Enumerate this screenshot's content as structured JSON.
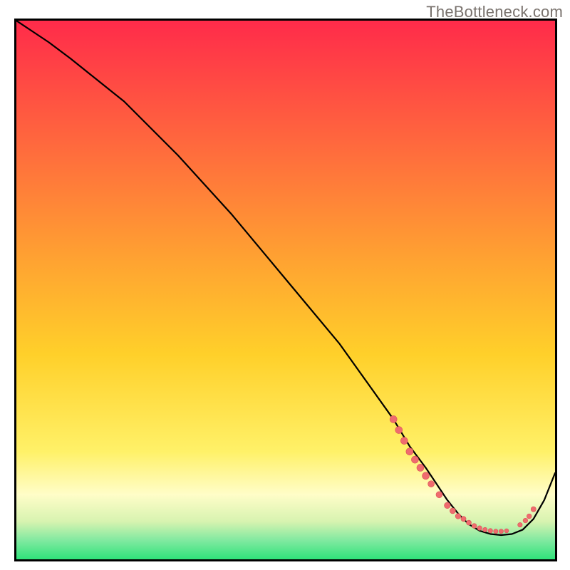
{
  "attribution": "TheBottleneck.com",
  "colors": {
    "top": "#ff2b4a",
    "mid": "#ffd02a",
    "pale": "#fffdc8",
    "green": "#2fe37a",
    "curve": "#000000",
    "dot_fill": "#ef6b6e",
    "dot_stroke": "#da5457"
  },
  "chart_data": {
    "type": "line",
    "title": "",
    "xlabel": "",
    "ylabel": "",
    "xlim": [
      0,
      100
    ],
    "ylim": [
      0,
      100
    ],
    "x": [
      0,
      3,
      6,
      10,
      15,
      20,
      30,
      40,
      50,
      60,
      65,
      70,
      73,
      76,
      78,
      80,
      82,
      84,
      86,
      88,
      90,
      92,
      94,
      96,
      98,
      100
    ],
    "values": [
      100,
      98,
      96,
      93,
      89,
      85,
      75,
      64,
      52,
      40,
      33,
      26,
      21,
      17,
      14,
      11,
      8.5,
      6.5,
      5.3,
      4.7,
      4.5,
      4.7,
      5.5,
      7.5,
      11,
      16
    ],
    "gradient_stops": [
      {
        "offset": 0,
        "color": "#ff2b4a"
      },
      {
        "offset": 0.45,
        "color": "#ffa431"
      },
      {
        "offset": 0.62,
        "color": "#ffd02a"
      },
      {
        "offset": 0.8,
        "color": "#fff168"
      },
      {
        "offset": 0.88,
        "color": "#fffdc8"
      },
      {
        "offset": 0.93,
        "color": "#d7f3b0"
      },
      {
        "offset": 0.965,
        "color": "#80e9a0"
      },
      {
        "offset": 1.0,
        "color": "#2fe37a"
      }
    ],
    "dots": [
      {
        "x": 70.0,
        "y": 26.0,
        "r": 5
      },
      {
        "x": 71.0,
        "y": 24.0,
        "r": 5
      },
      {
        "x": 72.0,
        "y": 22.0,
        "r": 5
      },
      {
        "x": 73.0,
        "y": 20.0,
        "r": 5
      },
      {
        "x": 74.0,
        "y": 18.5,
        "r": 5
      },
      {
        "x": 75.0,
        "y": 17.0,
        "r": 5
      },
      {
        "x": 76.0,
        "y": 15.5,
        "r": 5
      },
      {
        "x": 77.0,
        "y": 14.0,
        "r": 4.5
      },
      {
        "x": 78.5,
        "y": 12.0,
        "r": 4.5
      },
      {
        "x": 80.0,
        "y": 10.0,
        "r": 4.3
      },
      {
        "x": 81.0,
        "y": 9.0,
        "r": 4.0
      },
      {
        "x": 82.0,
        "y": 8.0,
        "r": 3.8
      },
      {
        "x": 83.0,
        "y": 7.5,
        "r": 3.6
      },
      {
        "x": 84.0,
        "y": 6.8,
        "r": 3.5
      },
      {
        "x": 85.0,
        "y": 6.2,
        "r": 3.4
      },
      {
        "x": 86.0,
        "y": 5.8,
        "r": 3.3
      },
      {
        "x": 87.0,
        "y": 5.5,
        "r": 3.2
      },
      {
        "x": 88.0,
        "y": 5.3,
        "r": 3.2
      },
      {
        "x": 89.0,
        "y": 5.2,
        "r": 3.1
      },
      {
        "x": 90.0,
        "y": 5.2,
        "r": 3.1
      },
      {
        "x": 91.0,
        "y": 5.3,
        "r": 2.9
      },
      {
        "x": 93.5,
        "y": 6.4,
        "r": 3.2
      },
      {
        "x": 94.5,
        "y": 7.2,
        "r": 3.3
      },
      {
        "x": 95.2,
        "y": 8.0,
        "r": 3.4
      },
      {
        "x": 96.0,
        "y": 9.3,
        "r": 3.6
      }
    ]
  }
}
